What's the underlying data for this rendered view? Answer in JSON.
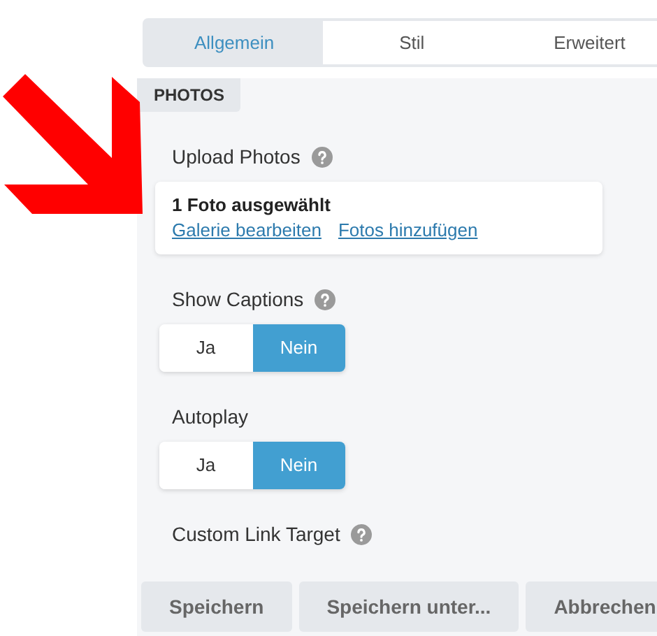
{
  "tabs": [
    {
      "label": "Allgemein",
      "selected": true
    },
    {
      "label": "Stil",
      "selected": false
    },
    {
      "label": "Erweitert",
      "selected": false
    }
  ],
  "section": {
    "title": "PHOTOS"
  },
  "fields": [
    {
      "kind": "photos",
      "label": "Upload Photos",
      "help": true,
      "summary": "1 Foto ausgewählt",
      "links": [
        "Galerie bearbeiten",
        "Fotos hinzufügen"
      ]
    },
    {
      "kind": "toggle",
      "label": "Show Captions",
      "help": true,
      "options": [
        {
          "label": "Ja",
          "selected": false
        },
        {
          "label": "Nein",
          "selected": true
        }
      ]
    },
    {
      "kind": "toggle",
      "label": "Autoplay",
      "help": false,
      "options": [
        {
          "label": "Ja",
          "selected": false
        },
        {
          "label": "Nein",
          "selected": true
        }
      ]
    },
    {
      "kind": "text",
      "label": "Custom Link Target",
      "help": true
    }
  ],
  "buttons": [
    "Speichern",
    "Speichern unter...",
    "Abbrechen"
  ]
}
